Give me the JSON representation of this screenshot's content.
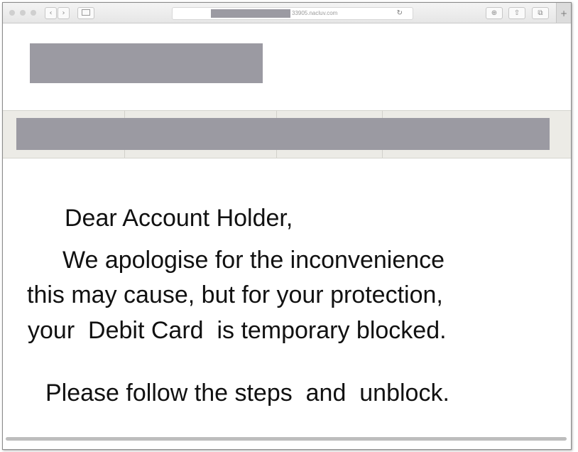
{
  "browser": {
    "url_visible_text": "33905.nacluv.com",
    "nav_back_glyph": "‹",
    "nav_forward_glyph": "›",
    "reload_glyph": "↻",
    "download_glyph": "⊕",
    "share_glyph": "⇧",
    "tabs_glyph": "⧉",
    "new_tab_glyph": "+"
  },
  "message": {
    "greeting": "Dear Account Holder,",
    "line1": "We apologise for the inconvenience",
    "line2": "this may cause, but for your protection,",
    "line3": "your  Debit Card  is temporary blocked.",
    "instruction": "Please follow the steps  and  unblock."
  },
  "colors": {
    "redaction": "#9b9aa2",
    "nav_background": "#ecebe6",
    "text": "#111111"
  }
}
